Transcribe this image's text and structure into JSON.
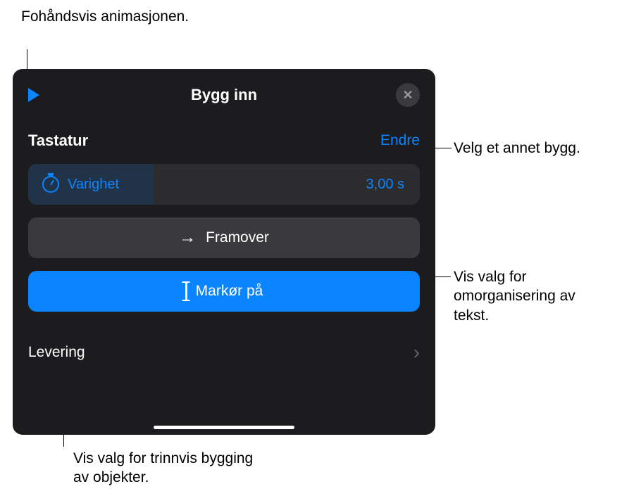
{
  "annotations": {
    "preview": "Fohåndsvis animasjonen.",
    "change": "Velg et annet bygg.",
    "direction": "Vis valg for omorganisering av tekst.",
    "delivery": "Vis valg for trinnvis bygging av objekter."
  },
  "panel": {
    "title": "Bygg inn",
    "section_label": "Tastatur",
    "change_link": "Endre",
    "duration": {
      "label": "Varighet",
      "value": "3,00 s"
    },
    "direction_label": "Framover",
    "marker_label": "Markør på",
    "delivery_label": "Levering"
  }
}
